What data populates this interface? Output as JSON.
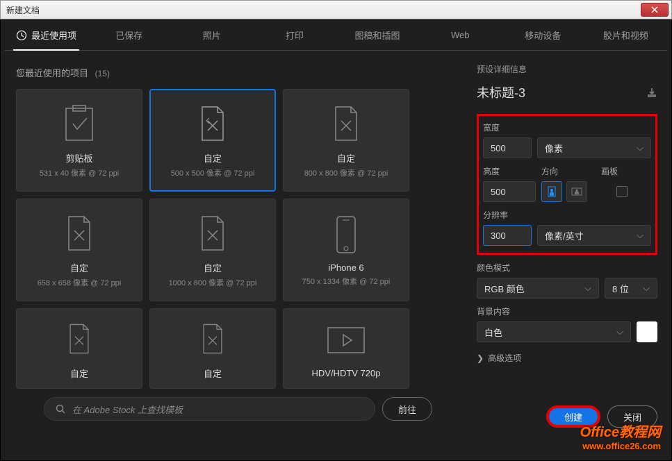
{
  "window": {
    "title": "新建文档"
  },
  "tabs": {
    "recent": "最近使用项",
    "saved": "已保存",
    "photo": "照片",
    "print": "打印",
    "artwork": "图稿和插图",
    "web": "Web",
    "mobile": "移动设备",
    "film": "胶片和视频"
  },
  "subtitle": {
    "label": "您最近使用的项目",
    "count": "(15)"
  },
  "presets": [
    {
      "name": "剪贴板",
      "spec": "531 x 40 像素 @ 72 ppi",
      "icon": "clipboard"
    },
    {
      "name": "自定",
      "spec": "500 x 500 像素 @ 72 ppi",
      "icon": "custom",
      "selected": true
    },
    {
      "name": "自定",
      "spec": "800 x 800 像素 @ 72 ppi",
      "icon": "custom"
    },
    {
      "name": "自定",
      "spec": "658 x 658 像素 @ 72 ppi",
      "icon": "custom"
    },
    {
      "name": "自定",
      "spec": "1000 x 800 像素 @ 72 ppi",
      "icon": "custom"
    },
    {
      "name": "iPhone 6",
      "spec": "750 x 1334 像素 @ 72 ppi",
      "icon": "mobile"
    },
    {
      "name": "自定",
      "spec": "",
      "icon": "custom"
    },
    {
      "name": "自定",
      "spec": "",
      "icon": "custom"
    },
    {
      "name": "HDV/HDTV 720p",
      "spec": "",
      "icon": "video"
    }
  ],
  "search": {
    "placeholder": "在 Adobe Stock 上查找模板",
    "go": "前往"
  },
  "details": {
    "header": "预设详细信息",
    "doc_name": "未标题-3",
    "width": {
      "label": "宽度",
      "value": "500",
      "unit": "像素"
    },
    "height": {
      "label": "高度",
      "value": "500"
    },
    "orientation_label": "方向",
    "artboard_label": "画板",
    "resolution": {
      "label": "分辨率",
      "value": "300",
      "unit": "像素/英寸"
    },
    "color_mode": {
      "label": "颜色模式",
      "value": "RGB 颜色",
      "depth": "8 位"
    },
    "bg": {
      "label": "背景内容",
      "value": "白色"
    },
    "advanced": "高级选项",
    "create": "创建",
    "close": "关闭"
  },
  "watermark": {
    "brand": "Office教程网",
    "url": "www.office26.com"
  }
}
